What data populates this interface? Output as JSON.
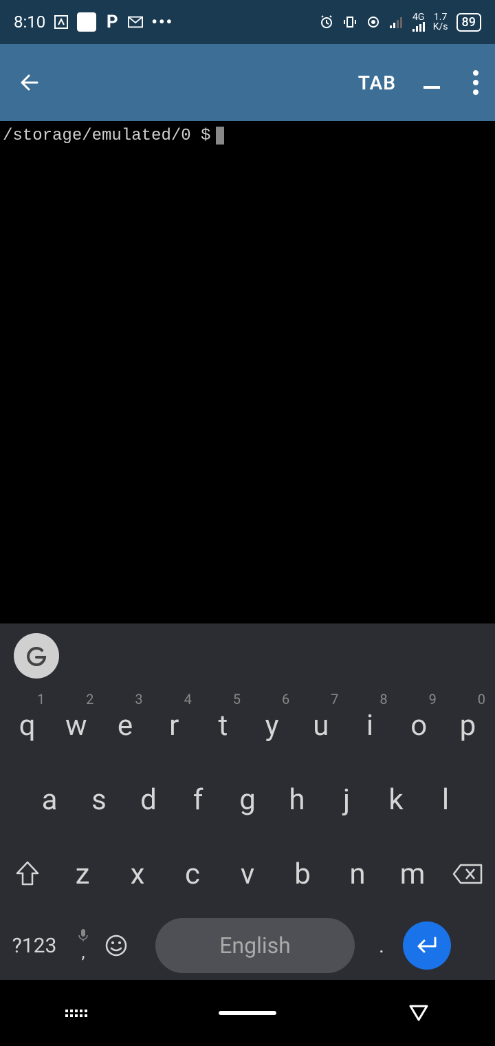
{
  "status": {
    "time": "8:10",
    "network_speed_top": "1.7",
    "network_speed_unit": "K/s",
    "network_type": "4G",
    "battery": "89"
  },
  "appbar": {
    "tab": "TAB"
  },
  "terminal": {
    "prompt": "/storage/emulated/0 $"
  },
  "keyboard": {
    "g_label": "G",
    "row1": [
      {
        "main": "q",
        "hint": "1"
      },
      {
        "main": "w",
        "hint": "2"
      },
      {
        "main": "e",
        "hint": "3"
      },
      {
        "main": "r",
        "hint": "4"
      },
      {
        "main": "t",
        "hint": "5"
      },
      {
        "main": "y",
        "hint": "6"
      },
      {
        "main": "u",
        "hint": "7"
      },
      {
        "main": "i",
        "hint": "8"
      },
      {
        "main": "o",
        "hint": "9"
      },
      {
        "main": "p",
        "hint": "0"
      }
    ],
    "row2": [
      "a",
      "s",
      "d",
      "f",
      "g",
      "h",
      "j",
      "k",
      "l"
    ],
    "row3": [
      "z",
      "x",
      "c",
      "v",
      "b",
      "n",
      "m"
    ],
    "sym": "?123",
    "space": "English",
    "dot": "."
  }
}
